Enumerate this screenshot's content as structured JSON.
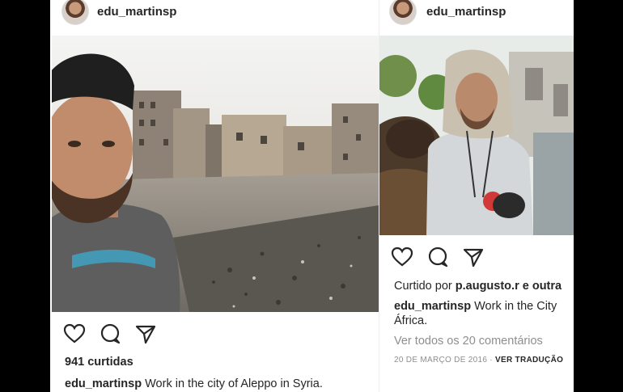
{
  "left_post": {
    "username": "edu_martinsp",
    "likes": "941 curtidas",
    "caption_user": "edu_martinsp",
    "caption_text": "Work in the city of Aleppo in Syria."
  },
  "right_post": {
    "username": "edu_martinsp",
    "liked_by_prefix": "Curtido por",
    "liked_by_user": "p.augusto.r",
    "liked_by_suffix": "e outra",
    "caption_user": "edu_martinsp",
    "caption_text": "Work in the City",
    "caption_line2": "África.",
    "view_comments": "Ver todos os 20 comentários",
    "date": "20 DE MARÇO DE 2016",
    "separator": "·",
    "translate": "VER TRADUÇÃO"
  },
  "icons": [
    "heart-icon",
    "comment-icon",
    "share-icon"
  ],
  "colors": {
    "text": "#262626",
    "muted": "#8e8e8e",
    "background": "#000000"
  }
}
